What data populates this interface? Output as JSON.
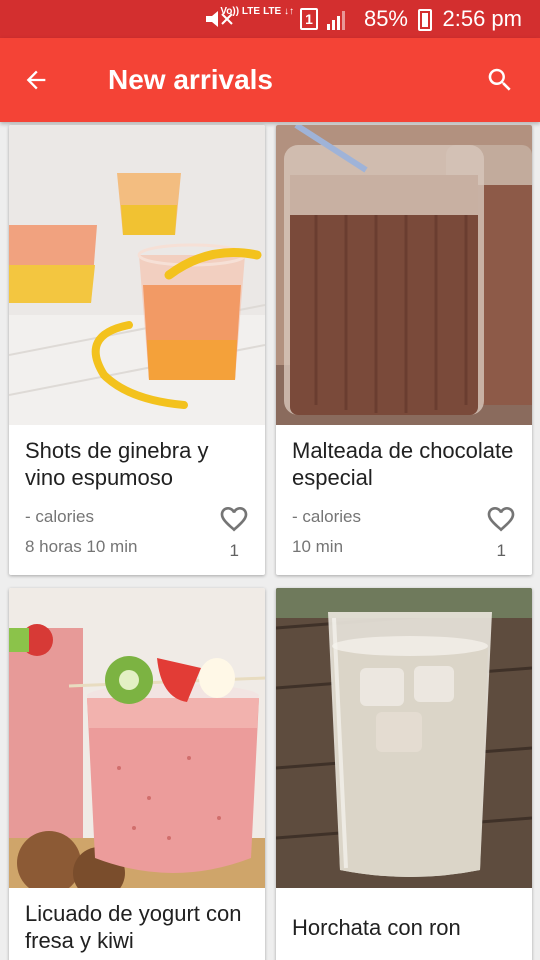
{
  "status_bar": {
    "time": "2:56 pm",
    "battery": "85%",
    "volte": "Vo)) LTE",
    "lte": "LTE ↓↑",
    "sim": "1"
  },
  "app_bar": {
    "title": "New arrivals",
    "back_icon": "arrow-back-icon",
    "search_icon": "search-icon"
  },
  "colors": {
    "status_bar": "#d32f2f",
    "app_bar": "#f44336",
    "background": "#eeeeee"
  },
  "recipes": [
    {
      "name": "Shots de ginebra y vino espumoso",
      "calories": "- calories",
      "time": "8 horas 10 min",
      "likes": "1",
      "image": "orange-gin-shots"
    },
    {
      "name": "Malteada de chocolate especial",
      "calories": "- calories",
      "time": "10 min",
      "likes": "1",
      "image": "chocolate-milkshake"
    },
    {
      "name": "Licuado de yogurt con fresa y kiwi",
      "image": "strawberry-kiwi-smoothie"
    },
    {
      "name": "Horchata con ron",
      "image": "horchata-glass"
    }
  ]
}
